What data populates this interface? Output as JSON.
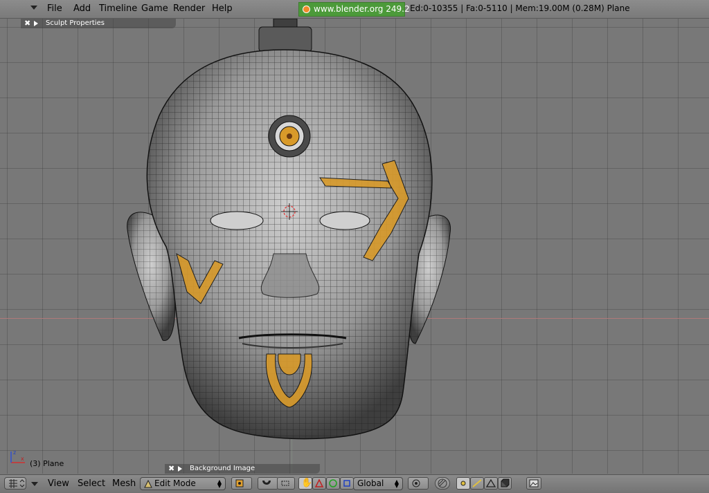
{
  "menubar": {
    "items": [
      "File",
      "Add",
      "Timeline",
      "Game",
      "Render",
      "Help"
    ],
    "website": "www.blender.org 249.2",
    "stats": "Ed:0-10355 | Fa:0-5110 | Mem:19.00M (0.28M) Plane"
  },
  "panels": {
    "sculpt": {
      "title": "Sculpt Properties",
      "close": "✖"
    },
    "background": {
      "title": "Background Image",
      "close": "✖"
    }
  },
  "viewport": {
    "object_label": "(3) Plane",
    "axis_x": "x",
    "axis_z": "z",
    "accent_color": "#d89a2a"
  },
  "header": {
    "menus": [
      "View",
      "Select",
      "Mesh"
    ],
    "mode": "Edit Mode",
    "orientation": "Global"
  }
}
